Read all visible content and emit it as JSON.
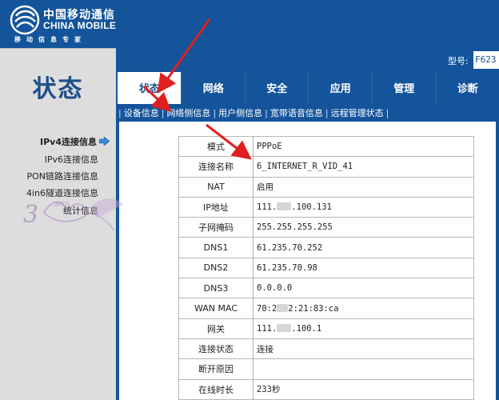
{
  "brand": {
    "name_cn": "中国移动通信",
    "name_en": "CHINA MOBILE",
    "slogan": "移动信息专家"
  },
  "page_heading": "状态",
  "model": {
    "label": "型号:",
    "value": "F623"
  },
  "tabs": [
    {
      "label": "状态",
      "active": true
    },
    {
      "label": "网络",
      "active": false
    },
    {
      "label": "安全",
      "active": false
    },
    {
      "label": "应用",
      "active": false
    },
    {
      "label": "管理",
      "active": false
    },
    {
      "label": "诊断",
      "active": false
    }
  ],
  "subnav": [
    {
      "label": "设备信息"
    },
    {
      "label": "网络侧信息"
    },
    {
      "label": "用户侧信息"
    },
    {
      "label": "宽带语音信息"
    },
    {
      "label": "远程管理状态"
    }
  ],
  "sidebar": [
    {
      "label": "IPv4连接信息",
      "active": true
    },
    {
      "label": "IPv6连接信息",
      "active": false
    },
    {
      "label": "PON链路连接信息",
      "active": false
    },
    {
      "label": "4in6隧道连接信息",
      "active": false
    },
    {
      "label": "统计信息",
      "active": false
    }
  ],
  "wan_info": {
    "rows": [
      {
        "label": "模式",
        "value": "PPPoE"
      },
      {
        "label": "连接名称",
        "value": "6_INTERNET_R_VID_41"
      },
      {
        "label": "NAT",
        "value": "启用"
      },
      {
        "label": "IP地址",
        "value_pre": "111.",
        "value_post": ".100.131"
      },
      {
        "label": "子网掩码",
        "value": "255.255.255.255"
      },
      {
        "label": "DNS1",
        "value": "61.235.70.252"
      },
      {
        "label": "DNS2",
        "value": "61.235.70.98"
      },
      {
        "label": "DNS3",
        "value": "0.0.0.0"
      },
      {
        "label": "WAN MAC",
        "value_pre": "70:2",
        "value_post": "2:21:83:ca"
      },
      {
        "label": "网关",
        "value_pre": "111.",
        "value_post": ".100.1"
      },
      {
        "label": "连接状态",
        "value": "连接"
      },
      {
        "label": "断开原因",
        "value": ""
      },
      {
        "label": "在线时长",
        "value": "233秒"
      }
    ]
  },
  "watermark": {
    "text": "3PCS",
    "logo": "butterfly-watermark"
  },
  "colors": {
    "primary": "#14549a",
    "heading": "#1e4f8d",
    "panel": "#dddddd",
    "annotation": "#e02020"
  }
}
